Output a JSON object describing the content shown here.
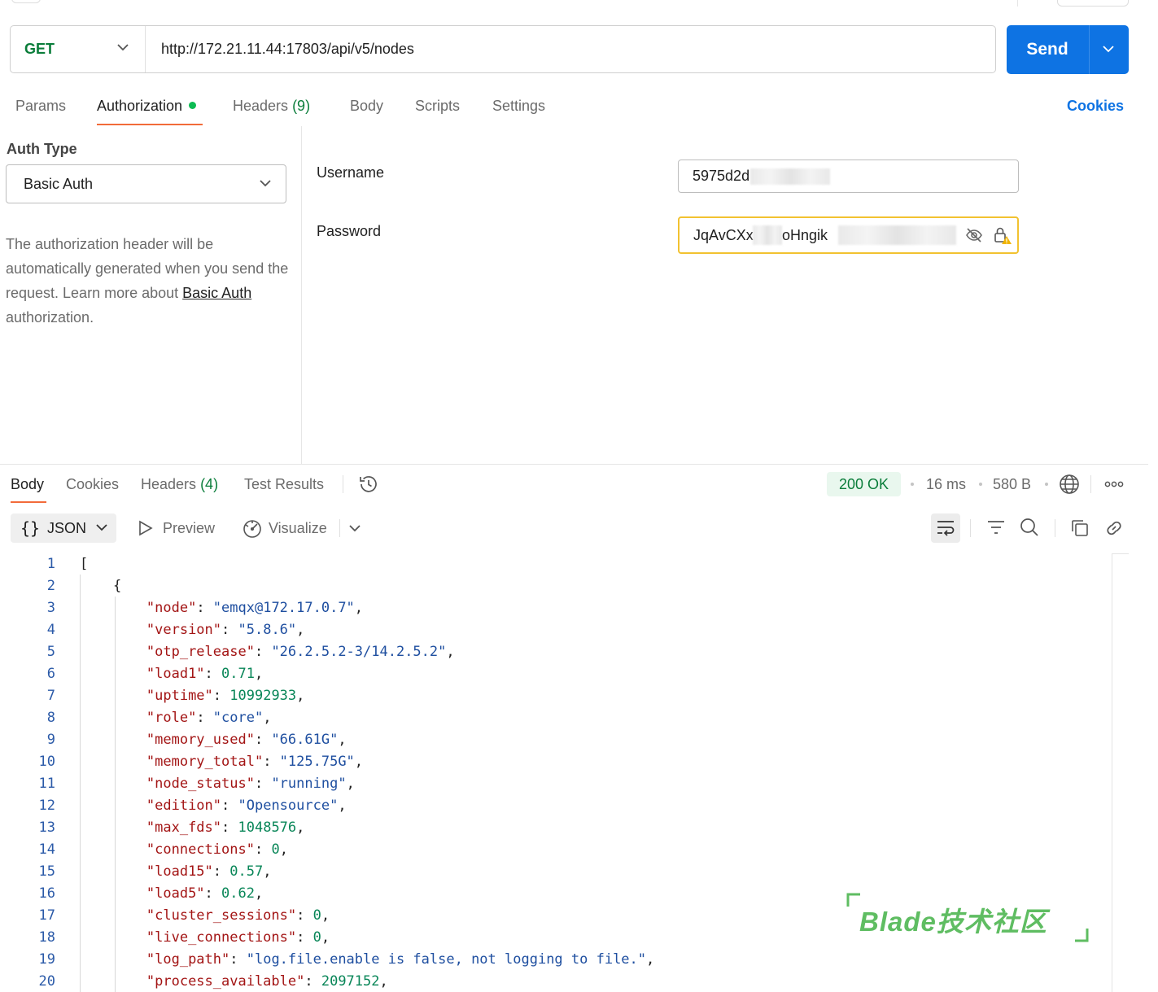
{
  "request": {
    "method": "GET",
    "url": "http://172.21.11.44:17803/api/v5/nodes",
    "send_label": "Send"
  },
  "request_tabs": [
    {
      "label": "Params",
      "count": ""
    },
    {
      "label": "Authorization",
      "count": ""
    },
    {
      "label": "Headers",
      "count": "(9)"
    },
    {
      "label": "Body",
      "count": ""
    },
    {
      "label": "Scripts",
      "count": ""
    },
    {
      "label": "Settings",
      "count": ""
    }
  ],
  "cookies_link": "Cookies",
  "auth": {
    "type_label": "Auth Type",
    "type_value": "Basic Auth",
    "description_text": "The authorization header will be automatically generated when you send the request. Learn more about",
    "description_link": "Basic Auth",
    "description_tail": " authorization.",
    "username_label": "Username",
    "username_value": "5975d2d",
    "password_label": "Password",
    "password_value": "JqAvCXx2",
    "password_value_2": "oHngik"
  },
  "response_tabs": [
    {
      "label": "Body",
      "count": ""
    },
    {
      "label": "Cookies",
      "count": ""
    },
    {
      "label": "Headers",
      "count": "(4)"
    },
    {
      "label": "Test Results",
      "count": ""
    }
  ],
  "response_meta": {
    "status": "200 OK",
    "time": "16 ms",
    "size": "580 B"
  },
  "viewer": {
    "format": "JSON",
    "preview": "Preview",
    "visualize": "Visualize"
  },
  "code_lines": [
    "[",
    "    {",
    "        \"node\": \"emqx@172.17.0.7\",",
    "        \"version\": \"5.8.6\",",
    "        \"otp_release\": \"26.2.5.2-3/14.2.5.2\",",
    "        \"load1\": 0.71,",
    "        \"uptime\": 10992933,",
    "        \"role\": \"core\",",
    "        \"memory_used\": \"66.61G\",",
    "        \"memory_total\": \"125.75G\",",
    "        \"node_status\": \"running\",",
    "        \"edition\": \"Opensource\",",
    "        \"max_fds\": 1048576,",
    "        \"connections\": 0,",
    "        \"load15\": 0.57,",
    "        \"load5\": 0.62,",
    "        \"cluster_sessions\": 0,",
    "        \"live_connections\": 0,",
    "        \"log_path\": \"log.file.enable is false, not logging to file.\",",
    "        \"process_available\": 2097152,"
  ],
  "watermark": "Blade技术社区",
  "colors": {
    "accent": "#0e73e3",
    "method_get": "#0a7d3a",
    "tab_underline": "#f26b3a",
    "status_ok_bg": "#e9f7ee",
    "password_warning_border": "#f2c230"
  },
  "icons": [
    "chevron-down-icon",
    "eye-off-icon",
    "lock-warning-icon",
    "history-icon",
    "globe-icon",
    "more-icon",
    "play-icon",
    "visualize-icon",
    "wrap-icon",
    "filter-icon",
    "search-icon",
    "copy-icon",
    "link-icon"
  ]
}
